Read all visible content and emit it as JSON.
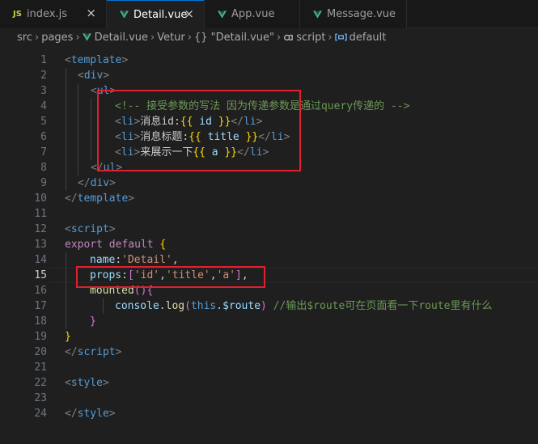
{
  "tabs": [
    {
      "label": "index.js",
      "icon": "js-icon",
      "active": false
    },
    {
      "label": "Detail.vue",
      "icon": "vue-icon",
      "active": true
    },
    {
      "label": "App.vue",
      "icon": "vue-icon",
      "active": false
    },
    {
      "label": "Message.vue",
      "icon": "vue-icon",
      "active": false
    }
  ],
  "close_glyph": "×",
  "breadcrumb": {
    "items": [
      "src",
      "pages",
      "Detail.vue",
      "Vetur",
      "{} \"Detail.vue\"",
      "script",
      "default"
    ],
    "separator": "›"
  },
  "line_numbers": [
    "1",
    "2",
    "3",
    "4",
    "5",
    "6",
    "7",
    "8",
    "9",
    "10",
    "11",
    "12",
    "13",
    "14",
    "15",
    "16",
    "17",
    "18",
    "19",
    "20",
    "21",
    "22",
    "23",
    "24"
  ],
  "current_line": "15",
  "code": {
    "l1": {
      "open": "<",
      "tag": "template",
      "close": ">"
    },
    "l2": {
      "open": "<",
      "tag": "div",
      "close": ">"
    },
    "l3": {
      "open": "<",
      "tag": "ul",
      "close": ">"
    },
    "l4": {
      "comment": "<!-- 接受参数的写法 因为传递参数是通过query传递的 -->"
    },
    "l5": {
      "open": "<",
      "tag": "li",
      "close": ">",
      "text": "消息id:",
      "mo": "{{",
      "expr": " id ",
      "mc": "}}",
      "etag": "</",
      "etagname": "li",
      "eclose": ">"
    },
    "l6": {
      "open": "<",
      "tag": "li",
      "close": ">",
      "text": "消息标题:",
      "mo": "{{",
      "expr": " title ",
      "mc": "}}",
      "etag": "</",
      "etagname": "li",
      "eclose": ">"
    },
    "l7": {
      "open": "<",
      "tag": "li",
      "close": ">",
      "text": "来展示一下",
      "mo": "{{",
      "expr": " a ",
      "mc": "}}",
      "etag": "</",
      "etagname": "li",
      "eclose": ">"
    },
    "l8": {
      "open": "</",
      "tag": "ul",
      "close": ">"
    },
    "l9": {
      "open": "</",
      "tag": "div",
      "close": ">"
    },
    "l10": {
      "open": "</",
      "tag": "template",
      "close": ">"
    },
    "l12": {
      "open": "<",
      "tag": "script",
      "close": ">"
    },
    "l13": {
      "kw1": "export",
      "kw2": "default",
      "brace": "{"
    },
    "l14": {
      "key": "name",
      "colon": ":",
      "str": "'Detail'",
      "comma": ","
    },
    "l15": {
      "key": "props",
      "colon": ":",
      "lb": "[",
      "s1": "'id'",
      "c1": ",",
      "s2": "'title'",
      "c2": ",",
      "s3": "'a'",
      "rb": "]",
      "comma": ","
    },
    "l16": {
      "fn": "mounted",
      "paren": "()",
      "brace": "{"
    },
    "l17": {
      "obj": "console",
      "dot": ".",
      "fn": "log",
      "lp": "(",
      "this": "this",
      "prop": ".$route",
      "rp": ")",
      "comment": " //输出$route可在页面看一下route里有什么"
    },
    "l18": {
      "brace": "}"
    },
    "l19": {
      "brace": "}"
    },
    "l20": {
      "open": "</",
      "tag": "script",
      "close": ">"
    },
    "l22": {
      "open": "<",
      "tag": "style",
      "close": ">"
    },
    "l24": {
      "open": "</",
      "tag": "style",
      "close": ">"
    }
  }
}
